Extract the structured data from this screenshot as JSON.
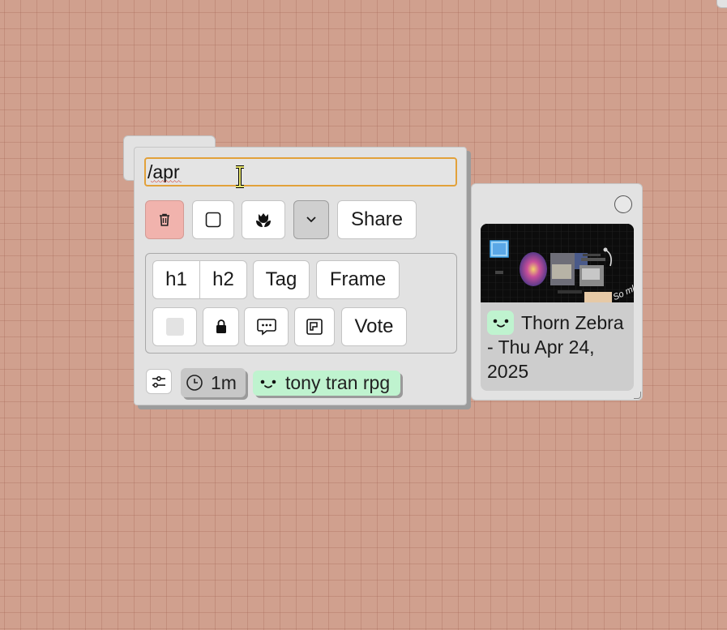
{
  "editor": {
    "search_value": "/apr",
    "toolbar": {
      "delete_icon": "trash-icon",
      "shape_icon": "square-icon",
      "flower_icon": "tulip-icon",
      "more_icon": "chevron-down-icon",
      "share_label": "Share"
    },
    "format": {
      "h1_label": "h1",
      "h2_label": "h2",
      "tag_label": "Tag",
      "frame_label": "Frame",
      "vote_label": "Vote",
      "color_icon": "color-swatch-icon",
      "lock_icon": "lock-icon",
      "comment_icon": "speech-bubble-icon",
      "layer_icon": "layer-icon"
    },
    "footer": {
      "settings_icon": "sliders-icon",
      "time_label": "1m",
      "user_label": "tony tran rpg"
    }
  },
  "card": {
    "title": "Thorn Zebra - Thu Apr 24, 2025",
    "thumbnail_caption": "So ml"
  },
  "colors": {
    "canvas": "#d0a08e",
    "search_border": "#e2a13a",
    "delete_button": "#f1b3ad",
    "user_pill": "#bff3cf"
  }
}
